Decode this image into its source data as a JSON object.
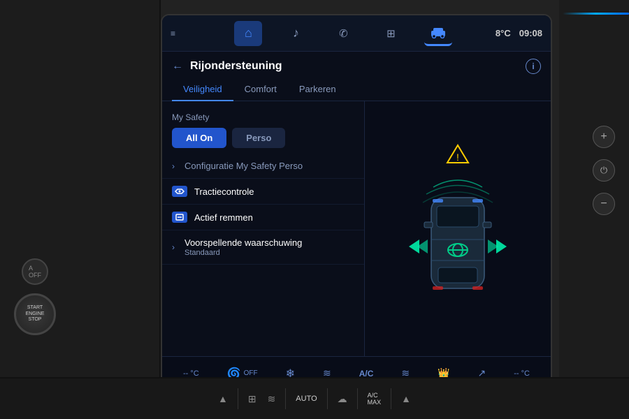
{
  "screen": {
    "temp": "8°C",
    "time": "09:08",
    "nav_icons": [
      {
        "name": "home",
        "symbol": "⌂",
        "active": false
      },
      {
        "name": "music",
        "symbol": "♪",
        "active": false
      },
      {
        "name": "phone",
        "symbol": "✆",
        "active": false
      },
      {
        "name": "apps",
        "symbol": "⊞",
        "active": false
      },
      {
        "name": "car",
        "symbol": "🚗",
        "active": true
      }
    ],
    "back_label": "←",
    "page_title": "Rijondersteuning",
    "info_label": "i",
    "tabs": [
      {
        "label": "Veiligheid",
        "active": true
      },
      {
        "label": "Comfort",
        "active": false
      },
      {
        "label": "Parkeren",
        "active": false
      }
    ],
    "section_title": "My Safety",
    "safety_buttons": [
      {
        "label": "All On",
        "active": true
      },
      {
        "label": "Perso",
        "active": false
      }
    ],
    "menu_items": [
      {
        "type": "arrow",
        "label": "Configuratie My Safety Perso",
        "sub": null
      },
      {
        "type": "icon",
        "label": "Tractiecontrole",
        "sub": null
      },
      {
        "type": "icon",
        "label": "Actief remmen",
        "sub": null
      },
      {
        "type": "arrow",
        "label": "Voorspellende waarschuwing",
        "sub": "Standaard"
      }
    ],
    "status_bar": [
      {
        "icon": "❄",
        "label": "-- °C"
      },
      {
        "icon": "💨",
        "label": "OFF"
      },
      {
        "icon": "☀",
        "label": ""
      },
      {
        "icon": "🔥",
        "label": ""
      },
      {
        "icon": "A/C",
        "label": "A/C"
      },
      {
        "icon": "≋",
        "label": ""
      },
      {
        "icon": "👑",
        "label": ""
      },
      {
        "icon": "↗",
        "label": ""
      },
      {
        "icon": "❄",
        "label": "-- °C"
      }
    ]
  },
  "bottom_bar": {
    "items": [
      {
        "icon": "▲",
        "label": ""
      },
      {
        "icon": "⊞",
        "label": ""
      },
      {
        "icon": "≋",
        "label": ""
      },
      {
        "icon": "AUTO",
        "label": "AUTO"
      },
      {
        "icon": "☁",
        "label": ""
      },
      {
        "icon": "A/C MAX",
        "label": "A/C MAX"
      },
      {
        "icon": "▲",
        "label": ""
      }
    ]
  },
  "engine_btn": {
    "label": "START\nENGINE\nSTOP"
  },
  "right_controls": [
    {
      "label": "+"
    },
    {
      "label": "⏻"
    },
    {
      "label": "−"
    }
  ]
}
